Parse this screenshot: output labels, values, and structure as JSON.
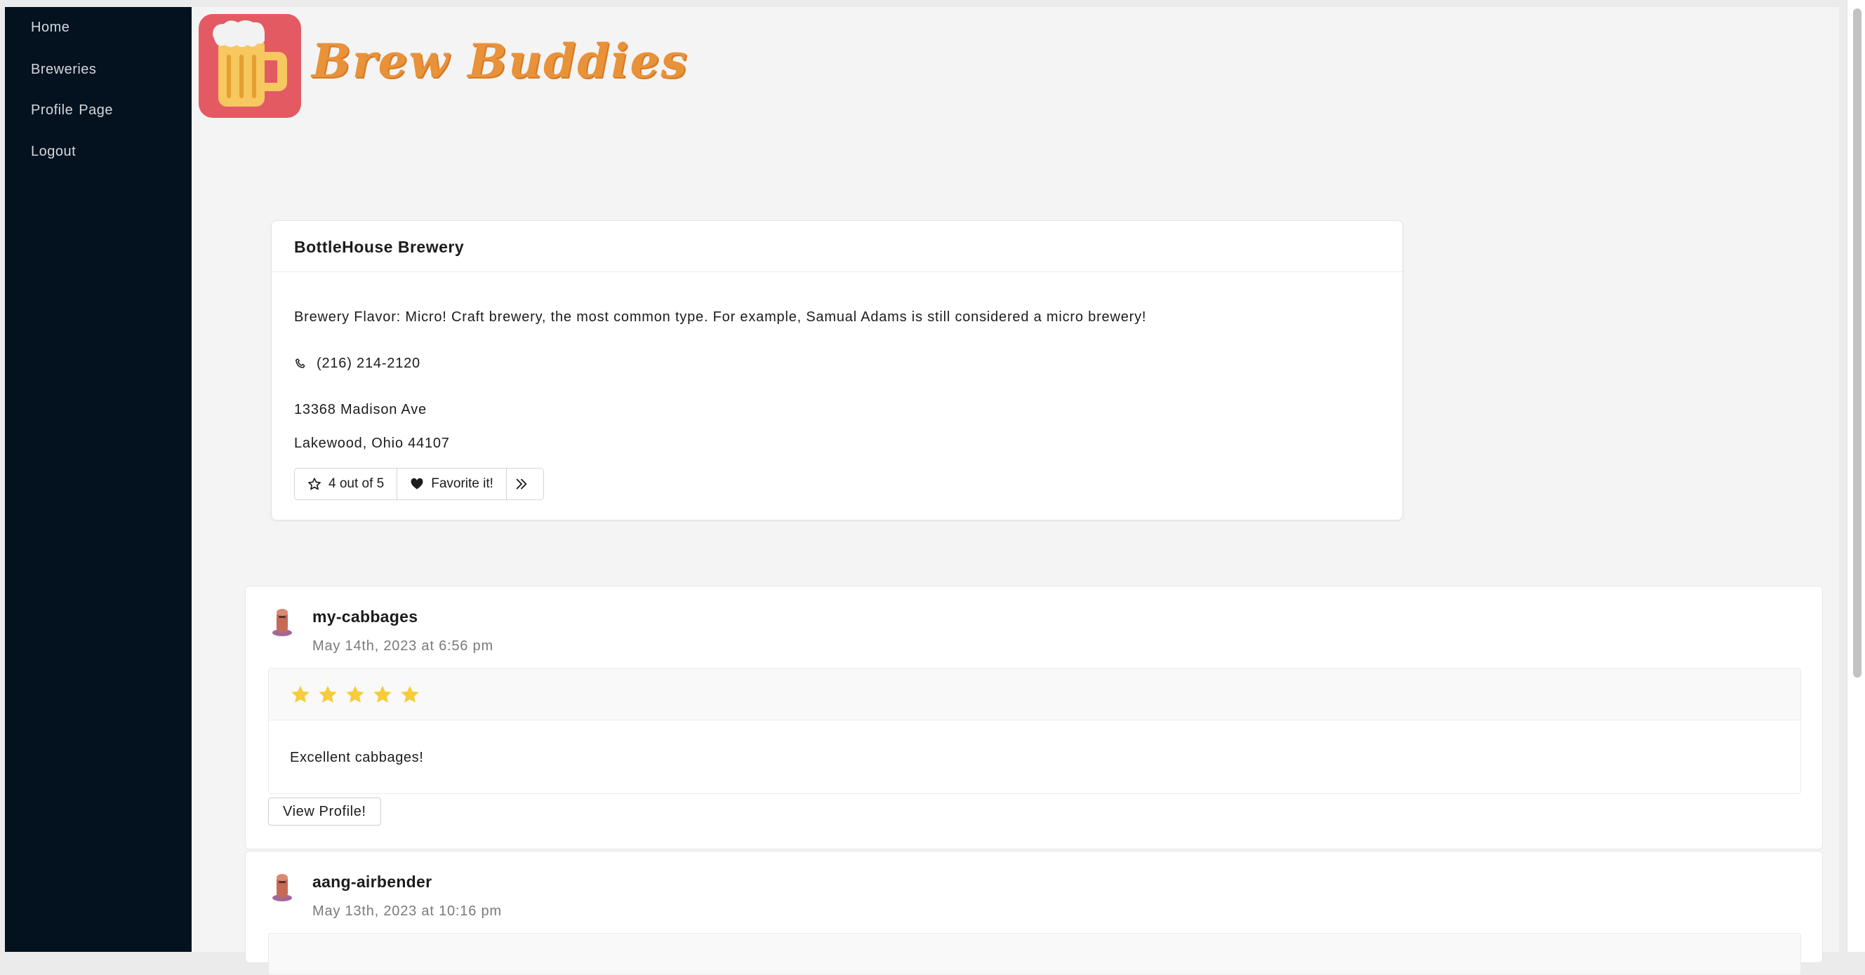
{
  "nav": {
    "items": [
      {
        "label": "Home"
      },
      {
        "label": "Breweries"
      },
      {
        "label": "Profile  Page"
      },
      {
        "label": "Logout"
      }
    ]
  },
  "header": {
    "brand": "Brew Buddies",
    "logo_icon": "beer-mug-icon"
  },
  "brewery": {
    "name": "BottleHouse  Brewery",
    "flavor": "Brewery  Flavor:  Micro!  Craft  brewery,  the  most  common  type.  For  example,  Samual  Adams  is  still  considered  a  micro  brewery!",
    "phone": "(216)  214-2120",
    "street": "13368  Madison  Ave",
    "city_line": "Lakewood,  Ohio  44107",
    "rating_label": "4 out of 5",
    "favorite_label": "Favorite it!"
  },
  "reviews": [
    {
      "username": "my-cabbages",
      "timestamp": "May  14th,  2023  at  6:56  pm",
      "rating": 5,
      "text": "Excellent  cabbages!",
      "view_label": "View  Profile!"
    },
    {
      "username": "aang-airbender",
      "timestamp": "May  13th,  2023  at  10:16  pm"
    }
  ],
  "colors": {
    "sidebar": "#04111f",
    "brand": "#e8923a",
    "star": "#f5cd3b",
    "logo_bg": "#e35a63"
  }
}
